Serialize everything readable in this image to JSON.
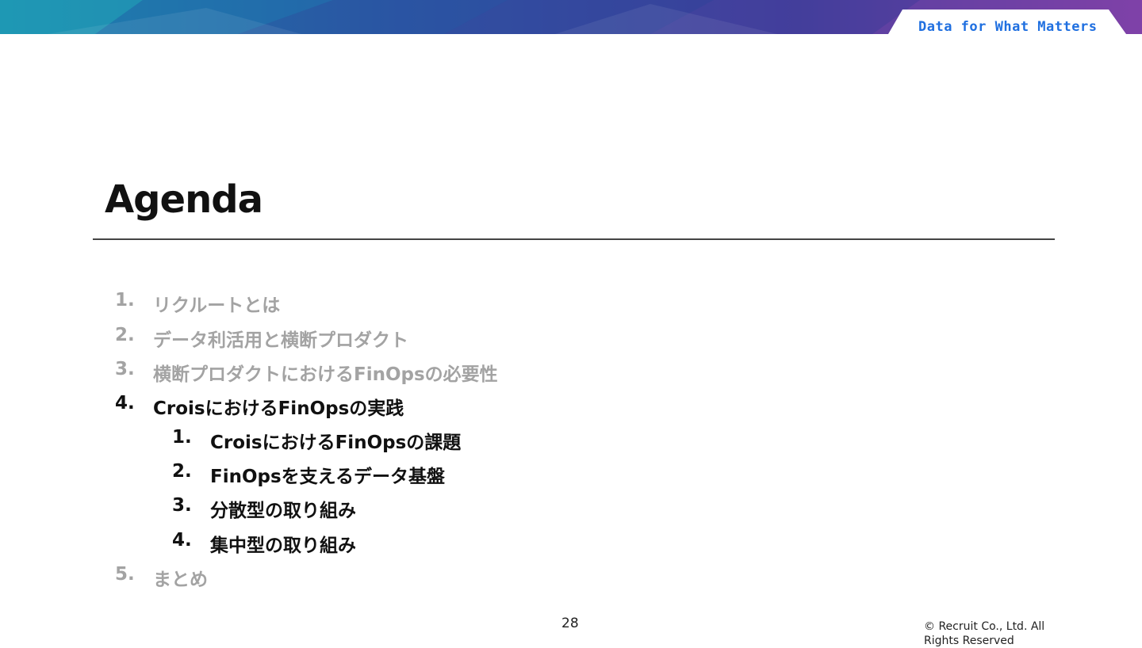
{
  "header": {
    "tagline": "Data for What Matters",
    "colors": {
      "banner_left": "#1c8fb0",
      "banner_mid": "#2a3f9a",
      "banner_right": "#7a3fa6",
      "tagline": "#1f6fe0"
    }
  },
  "slide": {
    "title": "Agenda",
    "agenda": [
      {
        "num": "1.",
        "label": "リクルートとは",
        "state": "dim"
      },
      {
        "num": "2.",
        "label": "データ利活用と横断プロダクト",
        "state": "dim"
      },
      {
        "num": "3.",
        "label": "横断プロダクトにおけるFinOpsの必要性",
        "state": "dim"
      },
      {
        "num": "4.",
        "label": "CroisにおけるFinOpsの実践",
        "state": "active",
        "children": [
          {
            "num": "1.",
            "label": "CroisにおけるFinOpsの課題"
          },
          {
            "num": "2.",
            "label": "FinOpsを支えるデータ基盤"
          },
          {
            "num": "3.",
            "label": "分散型の取り組み"
          },
          {
            "num": "4.",
            "label": "集中型の取り組み"
          }
        ]
      },
      {
        "num": "5.",
        "label": "まとめ",
        "state": "dim"
      }
    ]
  },
  "footer": {
    "page_number": "28",
    "copyright": "© Recruit Co., Ltd. All Rights Reserved"
  }
}
